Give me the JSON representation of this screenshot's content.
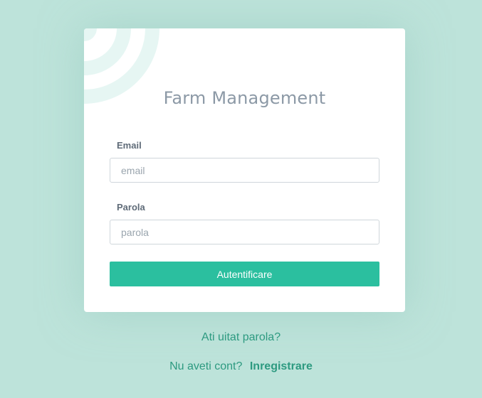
{
  "login": {
    "title": "Farm Management",
    "email_label": "Email",
    "email_placeholder": "email",
    "email_value": "",
    "password_label": "Parola",
    "password_placeholder": "parola",
    "password_value": "",
    "submit_label": "Autentificare"
  },
  "links": {
    "forgot_password": "Ati uitat parola?",
    "no_account_text": "Nu aveti cont?",
    "register_label": "Inregistrare"
  },
  "colors": {
    "background": "#bde3da",
    "accent": "#2bbf9f",
    "link": "#2d9a80",
    "decoration": "#e6f6f3"
  }
}
